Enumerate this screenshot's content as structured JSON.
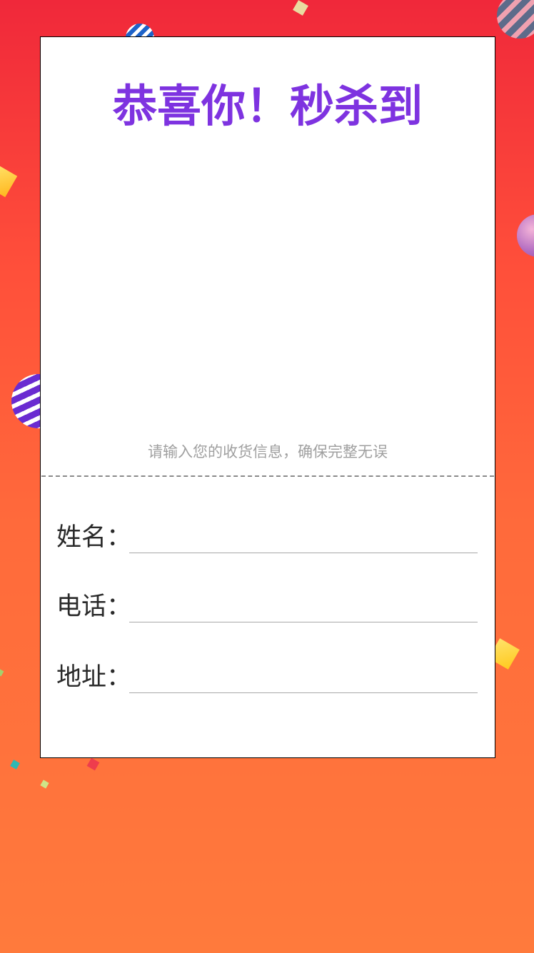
{
  "card": {
    "title": "恭喜你！秒杀到",
    "hint": "请输入您的收货信息，确保完整无误"
  },
  "form": {
    "name_label": "姓名：",
    "name_value": "",
    "phone_label": "电话：",
    "phone_value": "",
    "address_label": "地址：",
    "address_value": ""
  },
  "colors": {
    "background_top": "#f0283a",
    "background_bottom": "#ff7a3c",
    "title": "#7e33e0",
    "hint": "#a0a0a0",
    "divider": "#8a8a8a"
  }
}
